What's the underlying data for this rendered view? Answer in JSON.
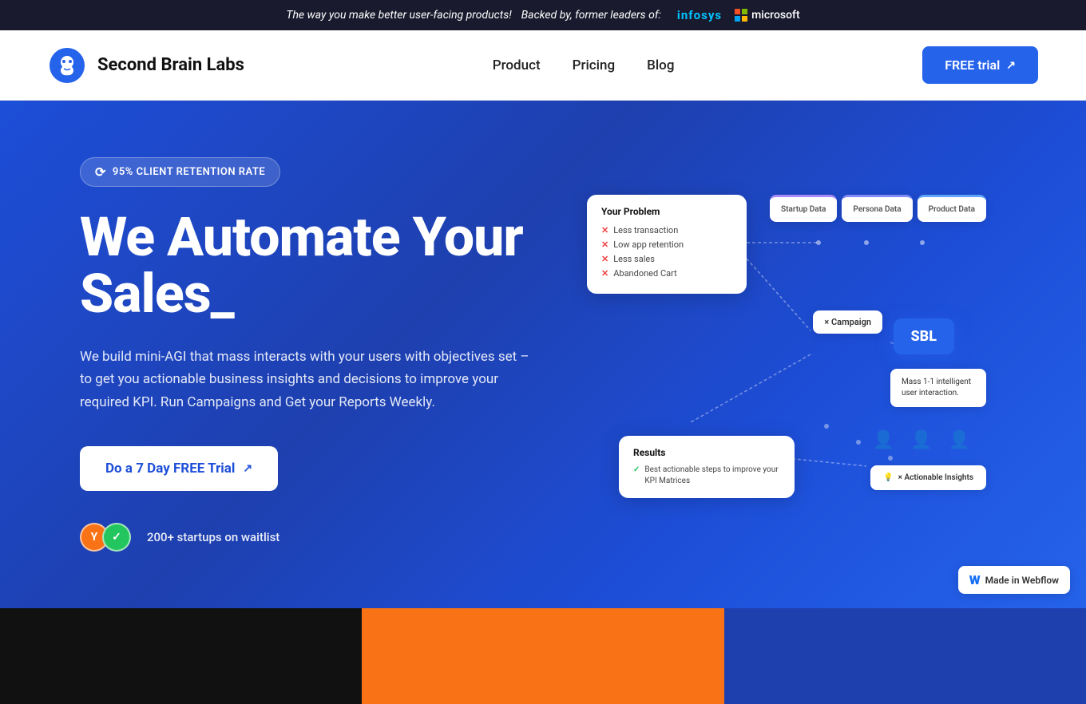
{
  "announcement": {
    "text_prefix": "The way you make better user-facing products!",
    "text_italic": "Backed by, former leaders of:",
    "infosys_label": "infosys",
    "microsoft_label": "microsoft"
  },
  "navbar": {
    "brand_name": "Second Brain Labs",
    "nav_links": [
      {
        "id": "product",
        "label": "Product"
      },
      {
        "id": "pricing",
        "label": "Pricing"
      },
      {
        "id": "blog",
        "label": "Blog"
      }
    ],
    "cta_label": "FREE trial",
    "cta_arrow": "↗"
  },
  "hero": {
    "badge_icon": "⟳",
    "badge_text": "95% CLIENT RETENTION RATE",
    "title_line1": "We Automate Your",
    "title_line2": "Sales_",
    "subtitle": "We build mini-AGI that mass interacts with your users with objectives set – to get you actionable business insights and decisions to improve your required KPI. Run Campaigns and Get your Reports Weekly.",
    "cta_label": "Do a 7 Day FREE Trial",
    "cta_arrow": "↗",
    "waitlist_count": "200+ startups on waitlist"
  },
  "diagram": {
    "problem_title": "Your Problem",
    "problem_items": [
      "Less transaction",
      "Low app retention",
      "Less sales",
      "Abandoned Cart"
    ],
    "data_cards": [
      {
        "label": "Startup\nData"
      },
      {
        "label": "Persona\nData"
      },
      {
        "label": "Product\nData"
      }
    ],
    "sbl_label": "SBL",
    "campaign_label": "× Campaign",
    "mass_label": "Mass 1-1 intelligent user interaction.",
    "results_title": "Results",
    "results_text": "Best actionable steps to improve your KPI Matrices",
    "insights_label": "× Actionable Insights"
  },
  "bottom_cards": [
    {
      "id": "dark",
      "bg": "#111"
    },
    {
      "id": "orange",
      "bg": "#f97316"
    },
    {
      "id": "blue",
      "bg": "#1e3a8a"
    }
  ],
  "webflow_badge": {
    "icon": "W",
    "label": "Made in Webflow"
  }
}
